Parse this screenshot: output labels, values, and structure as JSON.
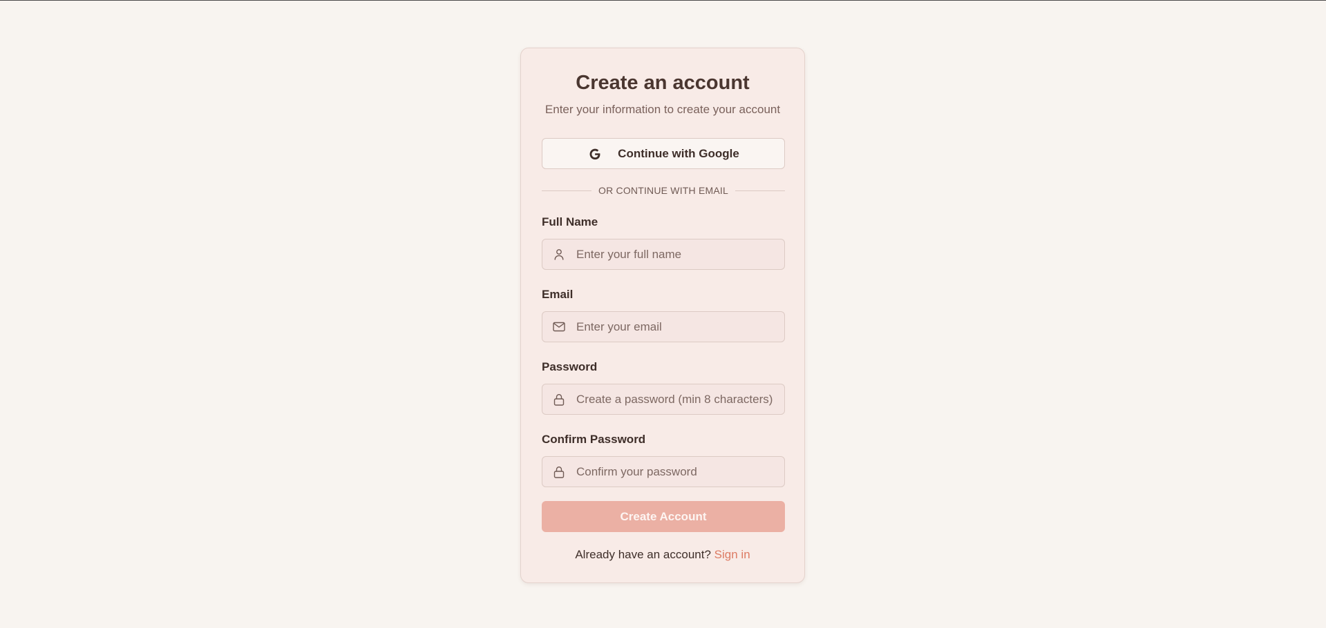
{
  "header": {
    "title": "Create an account",
    "subtitle": "Enter your information to create your account"
  },
  "google_button": {
    "icon": "google-icon",
    "label": "Continue with Google"
  },
  "divider": {
    "text": "OR CONTINUE WITH EMAIL"
  },
  "fields": [
    {
      "label": "Full Name",
      "icon": "user-icon",
      "value": "",
      "placeholder": "Enter your full name"
    },
    {
      "label": "Email",
      "icon": "mail-icon",
      "value": "",
      "placeholder": "Enter your email"
    },
    {
      "label": "Password",
      "icon": "lock-icon",
      "value": "",
      "placeholder": "Create a password (min 8 characters)"
    },
    {
      "label": "Confirm Password",
      "icon": "lock-icon",
      "value": "",
      "placeholder": "Confirm your password"
    }
  ],
  "submit_button": {
    "label": "Create Account",
    "state": "disabled"
  },
  "footer": {
    "prompt": "Already have an account?",
    "link_label": "Sign in"
  },
  "colors": {
    "background": "#f8f4f0",
    "card": "#f8ebe7",
    "accent": "#dd7b63",
    "submit_disabled": "#ebb0a4",
    "text_primary": "#3e2e29",
    "text_muted": "#7a615b"
  }
}
